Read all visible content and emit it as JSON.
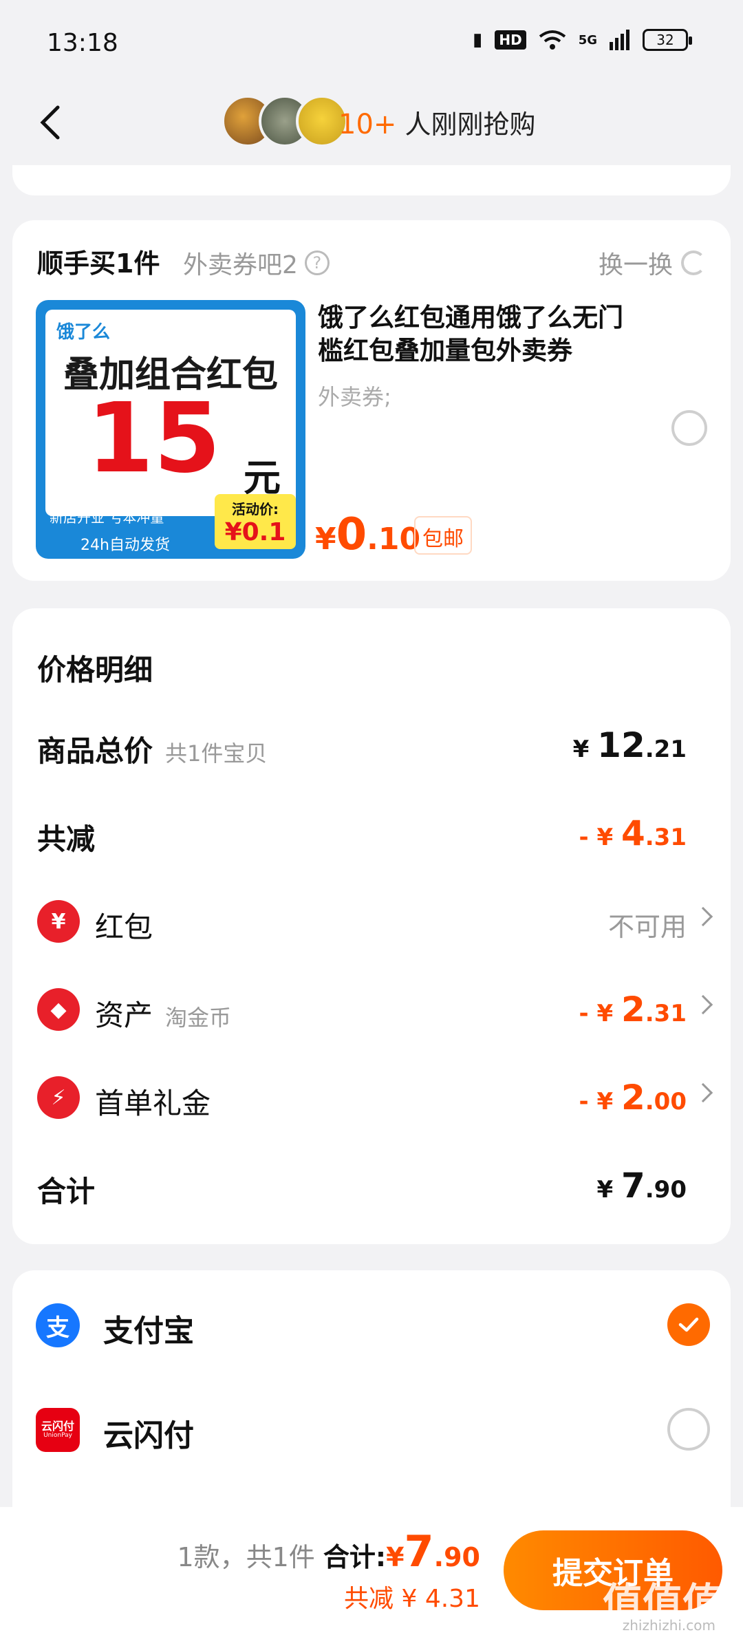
{
  "status_bar": {
    "time": "13:18",
    "network": "5G",
    "hd": "HD",
    "battery": "32"
  },
  "nav": {
    "buyers_count": "10+",
    "buyers_text": " 人刚刚抢购"
  },
  "addon": {
    "title": "顺手买1件",
    "subtitle": "外卖券吧2",
    "help_icon": "?",
    "refresh_label": "换一换",
    "image": {
      "brand": "饿了么",
      "headline": "叠加组合红包",
      "amount": "15",
      "unit": "元",
      "tags": "新店开业  亏本冲量",
      "ship": "24h自动发货",
      "act_label": "活动价:",
      "act_price": "¥0.1"
    },
    "product_name": "饿了么红包通用饿了么无门槛红包叠加量包外卖券",
    "category": "外卖券;",
    "price_symbol": "¥",
    "price_int": "0",
    "price_dec": ".10",
    "free_shipping": "包邮"
  },
  "price_detail": {
    "title": "价格明细",
    "goods_total": {
      "label": "商品总价",
      "sub": "共1件宝贝",
      "sym": "¥ ",
      "int": "12",
      "dec": ".21"
    },
    "total_less": {
      "label": "共减",
      "sym": "- ¥ ",
      "int": "4",
      "dec": ".31"
    },
    "red_packet": {
      "icon": "¥",
      "label": "红包",
      "value": "不可用"
    },
    "asset": {
      "icon": "◆",
      "label": "资产",
      "sub": "淘金币",
      "sym": "- ¥ ",
      "int": "2",
      "dec": ".31"
    },
    "first_order": {
      "icon": "⚡",
      "label": "首单礼金",
      "sym": "- ¥ ",
      "int": "2",
      "dec": ".00"
    },
    "total": {
      "label": "合计",
      "sym": "¥ ",
      "int": "7",
      "dec": ".90"
    }
  },
  "payment": {
    "alipay": {
      "icon": "支",
      "label": "支付宝",
      "selected": true
    },
    "unionpay": {
      "icon_top": "云闪付",
      "icon_bottom": "UnionPay",
      "label": "云闪付",
      "selected": false
    }
  },
  "bottom": {
    "count_text": "1款，共1件 ",
    "sum_label": "合计:",
    "sym": "¥",
    "int": "7",
    "dec": ".90",
    "less_text": "共减 ¥ 4.31",
    "submit_label": "提交订单"
  },
  "watermark": {
    "main": "值值值",
    "sub": "zhizhizhi.com"
  },
  "colors": {
    "accent": "#ff6a00",
    "price": "#ff4b00",
    "alipay": "#1677ff",
    "unionpay": "#e60012"
  }
}
